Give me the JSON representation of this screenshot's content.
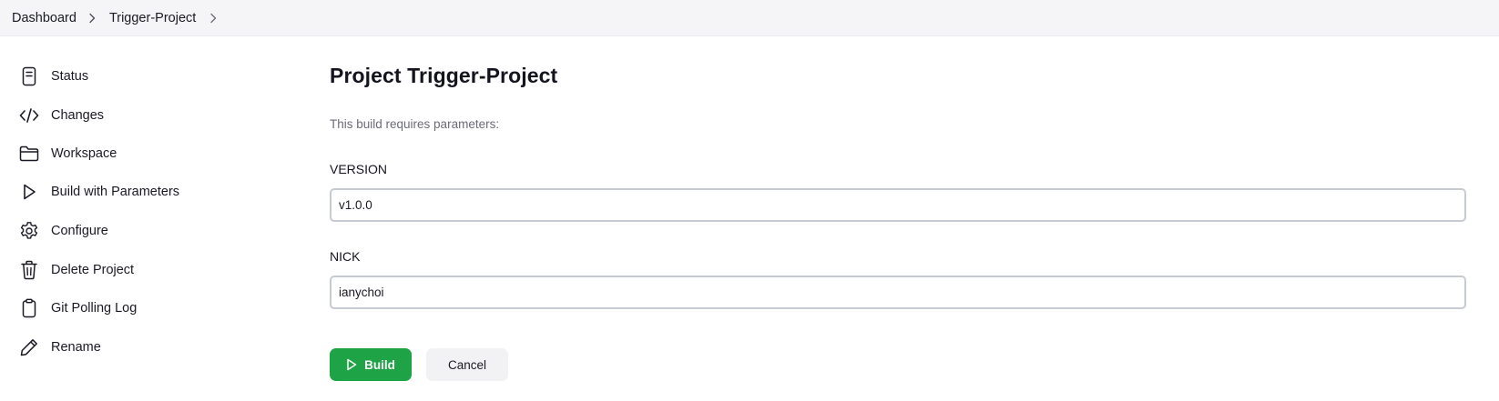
{
  "breadcrumb": {
    "items": [
      {
        "label": "Dashboard"
      },
      {
        "label": "Trigger-Project"
      }
    ],
    "separator_icon": "chevron-right-icon"
  },
  "sidebar": {
    "items": [
      {
        "label": "Status",
        "icon": "document-icon"
      },
      {
        "label": "Changes",
        "icon": "code-icon"
      },
      {
        "label": "Workspace",
        "icon": "folder-icon"
      },
      {
        "label": "Build with Parameters",
        "icon": "play-icon"
      },
      {
        "label": "Configure",
        "icon": "gear-icon"
      },
      {
        "label": "Delete Project",
        "icon": "trash-icon"
      },
      {
        "label": "Git Polling Log",
        "icon": "clipboard-icon"
      },
      {
        "label": "Rename",
        "icon": "pencil-icon"
      }
    ]
  },
  "main": {
    "title": "Project Trigger-Project",
    "description": "This build requires parameters:",
    "parameters": [
      {
        "name": "VERSION",
        "value": "v1.0.0"
      },
      {
        "name": "NICK",
        "value": "ianychoi"
      }
    ],
    "actions": {
      "build_label": "Build",
      "cancel_label": "Cancel"
    }
  },
  "colors": {
    "primary_button": "#1ea446",
    "breadcrumb_bg": "#f5f5f7",
    "input_border": "#c5cbd1",
    "muted_text": "#6b6b78"
  }
}
